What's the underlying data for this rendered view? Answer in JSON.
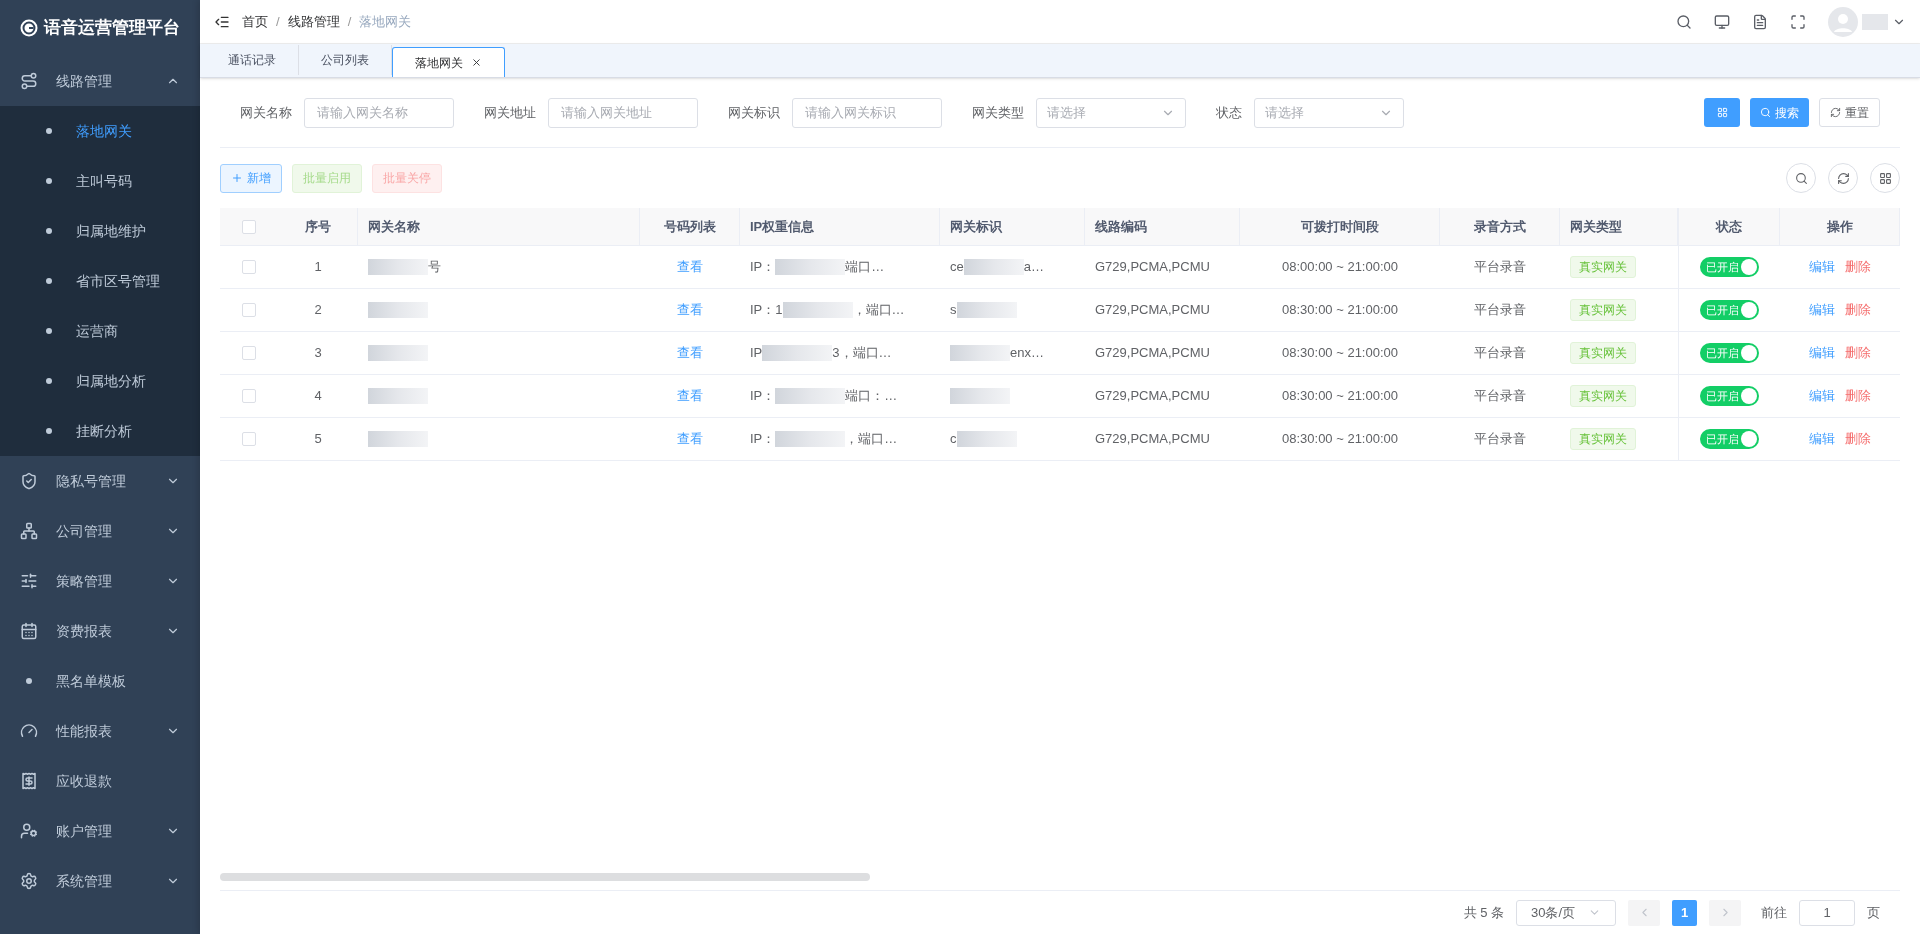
{
  "app": {
    "title": "语音运营管理平台"
  },
  "sidebar": {
    "items": [
      {
        "kind": "group",
        "label": "线路管理",
        "expanded": true,
        "children": [
          {
            "label": "落地网关",
            "selected": true
          },
          {
            "label": "主叫号码",
            "selected": false
          },
          {
            "label": "归属地维护",
            "selected": false
          },
          {
            "label": "省市区号管理",
            "selected": false
          },
          {
            "label": "运营商",
            "selected": false
          },
          {
            "label": "归属地分析",
            "selected": false
          },
          {
            "label": "挂断分析",
            "selected": false
          }
        ]
      },
      {
        "kind": "group",
        "label": "隐私号管理",
        "expanded": false
      },
      {
        "kind": "group",
        "label": "公司管理",
        "expanded": false
      },
      {
        "kind": "group",
        "label": "策略管理",
        "expanded": false
      },
      {
        "kind": "group",
        "label": "资费报表",
        "expanded": false
      },
      {
        "kind": "link",
        "label": "黑名单模板"
      },
      {
        "kind": "group",
        "label": "性能报表",
        "expanded": false
      },
      {
        "kind": "link",
        "label": "应收退款"
      },
      {
        "kind": "group",
        "label": "账户管理",
        "expanded": false
      },
      {
        "kind": "group",
        "label": "系统管理",
        "expanded": false
      }
    ]
  },
  "breadcrumb": {
    "separator": "/",
    "items": [
      "首页",
      "线路管理",
      "落地网关"
    ]
  },
  "tabs": [
    {
      "label": "通话记录",
      "selected": false,
      "closable": false
    },
    {
      "label": "公司列表",
      "selected": false,
      "closable": false
    },
    {
      "label": "落地网关",
      "selected": true,
      "closable": true
    }
  ],
  "filters": [
    {
      "kind": "input",
      "label": "网关名称",
      "placeholder": "请输入网关名称"
    },
    {
      "kind": "input",
      "label": "网关地址",
      "placeholder": "请输入网关地址"
    },
    {
      "kind": "input",
      "label": "网关标识",
      "placeholder": "请输入网关标识"
    },
    {
      "kind": "select",
      "label": "网关类型",
      "placeholder": "请选择"
    },
    {
      "kind": "select",
      "label": "状态",
      "placeholder": "请选择"
    }
  ],
  "filter_buttons": {
    "search": "搜索",
    "reset": "重置"
  },
  "actions": [
    {
      "kind": "primary",
      "label": "新增",
      "disabled": false
    },
    {
      "kind": "success",
      "label": "批量启用",
      "disabled": true
    },
    {
      "kind": "danger",
      "label": "批量关停",
      "disabled": true
    }
  ],
  "table": {
    "all_checked": false,
    "columns": [
      "序号",
      "网关名称",
      "号码列表",
      "IP权重信息",
      "网关标识",
      "线路编码",
      "可拨打时间段",
      "录音方式",
      "网关类型",
      "状态",
      "操作"
    ],
    "rows": [
      {
        "checked": false,
        "index": "1",
        "name": {
          "after": "号"
        },
        "numbers": "查看",
        "ip": {
          "before": "IP：",
          "after": "端口…"
        },
        "gateway_id": {
          "before": "ce",
          "after": "a…"
        },
        "codec": "G729,PCMA,PCMU",
        "time": "08:00:00 ~ 21:00:00",
        "recording": "平台录音",
        "type": "真实网关",
        "on": true,
        "status": "已开启",
        "edit": "编辑",
        "delete": "删除"
      },
      {
        "checked": false,
        "index": "2",
        "name": {},
        "numbers": "查看",
        "ip": {
          "before": "IP：1",
          "after": "，端口…"
        },
        "gateway_id": {
          "before": "s"
        },
        "codec": "G729,PCMA,PCMU",
        "time": "08:30:00 ~ 21:00:00",
        "recording": "平台录音",
        "type": "真实网关",
        "on": true,
        "status": "已开启",
        "edit": "编辑",
        "delete": "删除"
      },
      {
        "checked": false,
        "index": "3",
        "name": {},
        "numbers": "查看",
        "ip": {
          "before": "IP",
          "after": "3，端口…"
        },
        "gateway_id": {
          "after": "enx…"
        },
        "codec": "G729,PCMA,PCMU",
        "time": "08:30:00 ~ 21:00:00",
        "recording": "平台录音",
        "type": "真实网关",
        "on": true,
        "status": "已开启",
        "edit": "编辑",
        "delete": "删除"
      },
      {
        "checked": false,
        "index": "4",
        "name": {},
        "numbers": "查看",
        "ip": {
          "before": "IP：",
          "after": "端口：…"
        },
        "gateway_id": {},
        "codec": "G729,PCMA,PCMU",
        "time": "08:30:00 ~ 21:00:00",
        "recording": "平台录音",
        "type": "真实网关",
        "on": true,
        "status": "已开启",
        "edit": "编辑",
        "delete": "删除"
      },
      {
        "checked": false,
        "index": "5",
        "name": {},
        "numbers": "查看",
        "ip": {
          "before": "IP：",
          "after": "，端口…"
        },
        "gateway_id": {
          "before": "c"
        },
        "codec": "G729,PCMA,PCMU",
        "time": "08:30:00 ~ 21:00:00",
        "recording": "平台录音",
        "type": "真实网关",
        "on": true,
        "status": "已开启",
        "edit": "编辑",
        "delete": "删除"
      }
    ]
  },
  "pagination": {
    "total": "共 5 条",
    "page_size": "30条/页",
    "pages": [
      {
        "label": "1",
        "selected": true
      }
    ],
    "goto_label": "前往",
    "goto_value": "1",
    "page_suffix": "页"
  }
}
